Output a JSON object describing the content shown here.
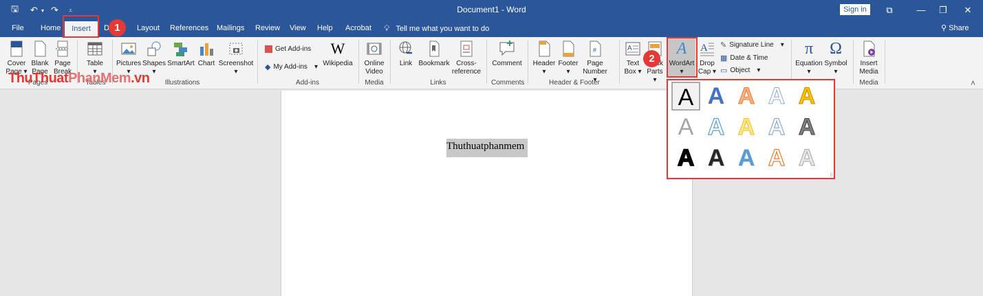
{
  "titlebar": {
    "doc_title": "Document1  -  Word",
    "signin": "Sign in",
    "qa_save": "🖫",
    "qa_undo": "↶",
    "qa_redo": "↷",
    "qa_customize": "⩡",
    "ribbon_options": "⧉",
    "minimize": "—",
    "restore": "❐",
    "close": "✕"
  },
  "tabs": {
    "file": "File",
    "home": "Home",
    "insert": "Insert",
    "draw": "D",
    "layout": "Layout",
    "references": "References",
    "mailings": "Mailings",
    "review": "Review",
    "view": "View",
    "help": "Help",
    "acrobat": "Acrobat",
    "tellme": "Tell me what you want to do",
    "share": "Share"
  },
  "ribbon": {
    "pages": {
      "cover_page": [
        "Cover",
        "Page ▾"
      ],
      "blank_page": [
        "Blank",
        "Page"
      ],
      "page_break": [
        "Page",
        "Break"
      ],
      "label": "Pages"
    },
    "tables": {
      "table": [
        "Table",
        "▾"
      ],
      "label": "Tables"
    },
    "illustrations": {
      "pictures": [
        "Pictures",
        "▾"
      ],
      "shapes": [
        "Shapes",
        "▾"
      ],
      "smartart": "SmartArt",
      "chart": "Chart",
      "screenshot": [
        "Screenshot",
        "▾"
      ],
      "label": "Illustrations"
    },
    "addins": {
      "get_addins": "Get Add-ins",
      "my_addins": "My Add-ins",
      "my_addins_arrow": "▾",
      "wikipedia": "Wikipedia",
      "label": "Add-ins"
    },
    "media": {
      "online_video": [
        "Online",
        "Video"
      ],
      "label": "Media"
    },
    "links": {
      "link": "Link",
      "bookmark": "Bookmark",
      "cross_reference": [
        "Cross-",
        "reference"
      ],
      "label": "Links"
    },
    "comments": {
      "comment": "Comment",
      "label": "Comments"
    },
    "header_footer": {
      "header": [
        "Header",
        "▾"
      ],
      "footer": [
        "Footer",
        "▾"
      ],
      "page_number": [
        "Page",
        "Number ▾"
      ],
      "label": "Header & Footer"
    },
    "text": {
      "text_box": [
        "Text",
        "Box ▾"
      ],
      "quick_parts": [
        "Quick",
        "Parts ▾"
      ],
      "quick_parts_visible": [
        "ck",
        "Parts ▾"
      ],
      "wordart": [
        "WordArt",
        "▾"
      ],
      "drop_cap": [
        "Drop",
        "Cap ▾"
      ],
      "signature_line": "Signature Line",
      "signature_arrow": "▾",
      "date_time": "Date & Time",
      "object": "Object",
      "object_arrow": "▾"
    },
    "symbols": {
      "equation": [
        "Equation",
        "▾"
      ],
      "symbol": [
        "Symbol",
        "▾"
      ]
    },
    "media2": {
      "insert_media": [
        "Insert",
        "Media"
      ],
      "label": "Media"
    },
    "collapse": "˄"
  },
  "watermark": {
    "part1": "ThuThuat",
    "part2": "PhanMem",
    "part3": ".vn"
  },
  "document": {
    "selected_text": "Thuthuatphanmem"
  },
  "gallery": {
    "glyph": "A"
  },
  "callouts": {
    "one": "1",
    "two": "2"
  }
}
